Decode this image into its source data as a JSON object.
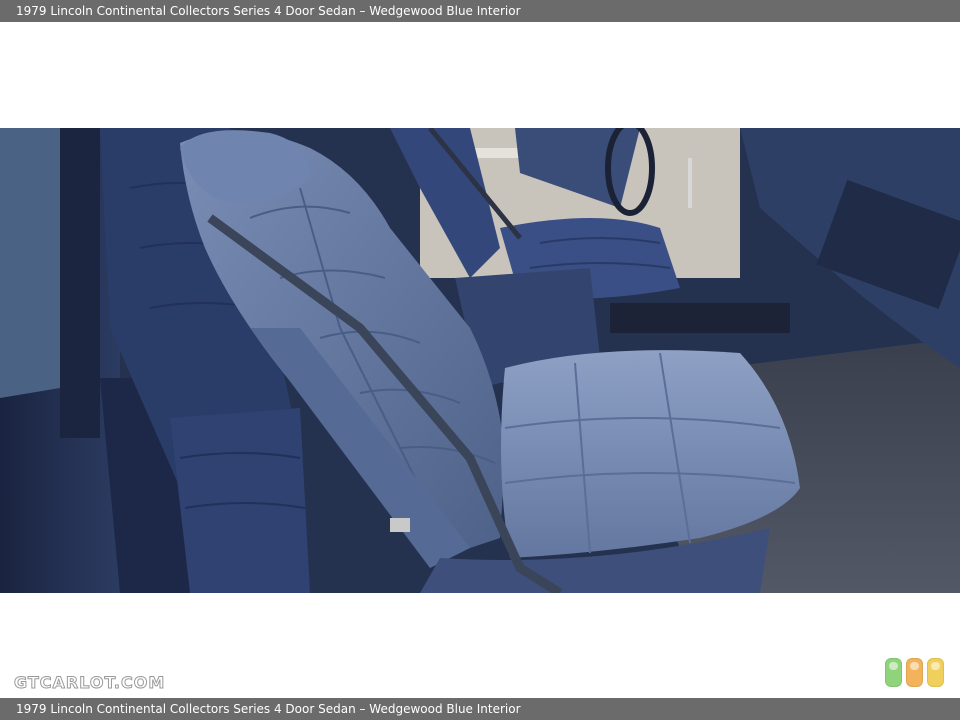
{
  "header": {
    "title": "1979 Lincoln Continental Collectors Series 4 Door Sedan – Wedgewood Blue Interior"
  },
  "photo": {
    "subject": "car-interior-front-seat"
  },
  "footer": {
    "title": "1979 Lincoln Continental Collectors Series 4 Door Sedan – Wedgewood Blue Interior",
    "logo_text": "GTCARLOT.COM",
    "indicator_colors": [
      "#8fd37a",
      "#f3b35a",
      "#f0d05a"
    ]
  },
  "colors": {
    "bar_background": "#6b6b6b",
    "bar_text": "#ffffff",
    "upholstery": "#5b6f9a",
    "carpet": "#3f4555"
  }
}
